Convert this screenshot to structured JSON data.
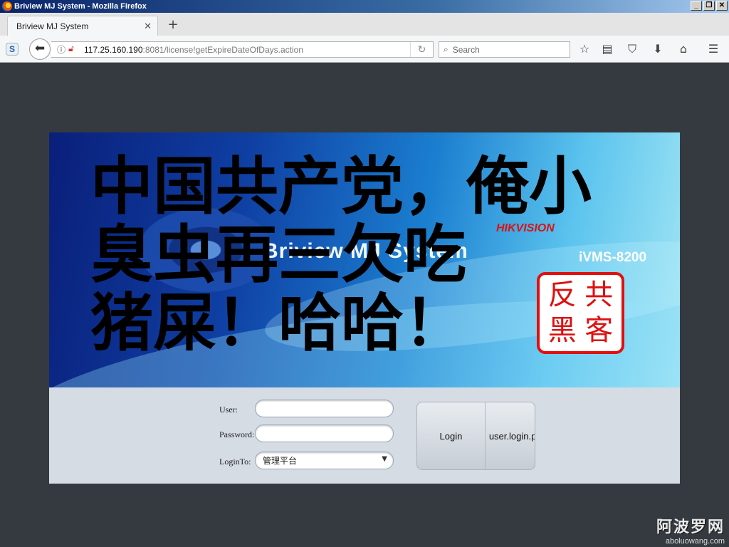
{
  "window": {
    "title": "Briview MJ System - Mozilla Firefox"
  },
  "tabs": [
    {
      "label": "Briview MJ System"
    }
  ],
  "nav": {
    "url_host": "117.25.160.190",
    "url_rest": ":8081/license!getExpireDateOfDays.action",
    "search_placeholder": "Search"
  },
  "banner": {
    "system_title": "Briview MJ System",
    "brand": "HIKVISION",
    "product": "iVMS-8200",
    "graffiti_line1": "中国共产党，俺小",
    "graffiti_line2": "臭虫再三欠吃",
    "graffiti_line3": "猪屎！哈哈！",
    "seal_chars": [
      "反",
      "共",
      "黑",
      "客"
    ]
  },
  "login": {
    "user_label": "User:",
    "password_label": "Password:",
    "loginto_label": "LoginTo:",
    "loginto_value": "管理平台",
    "login_button": "Login",
    "second_button": "user.login.p"
  },
  "watermark": {
    "main": "阿波罗网",
    "sub": "aboluowang.com"
  }
}
